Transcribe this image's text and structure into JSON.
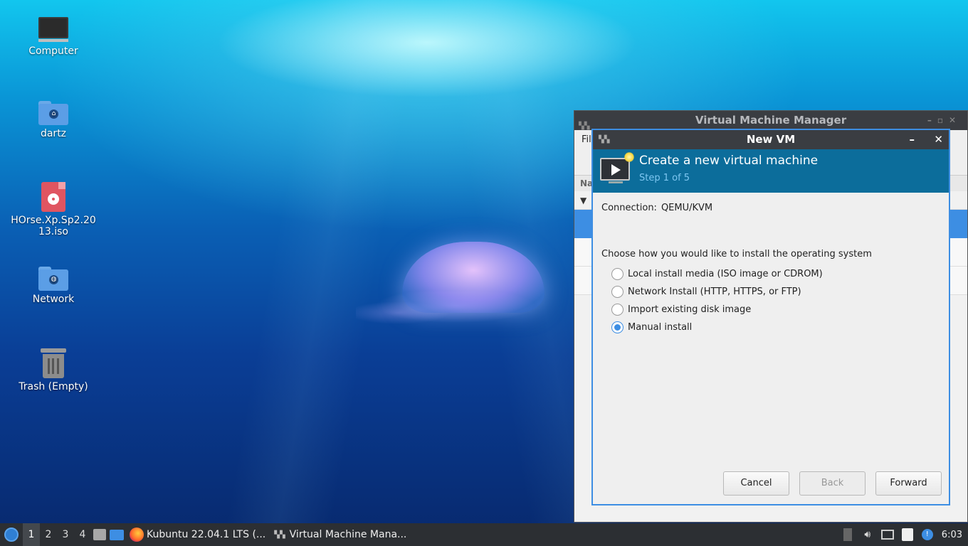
{
  "desktop": {
    "icons": [
      {
        "label": "Computer"
      },
      {
        "label": "dartz"
      },
      {
        "label": "HOrse.Xp.Sp2.2013.iso"
      },
      {
        "label": "Network"
      },
      {
        "label": "Trash (Empty)"
      }
    ]
  },
  "vmm_window": {
    "title": "Virtual Machine Manager",
    "menu_label": "Fil",
    "list_header": "Na"
  },
  "new_vm_dialog": {
    "title": "New VM",
    "heading": "Create a new virtual machine",
    "step": "Step 1 of 5",
    "connection_label": "Connection:",
    "connection_value": "QEMU/KVM",
    "prompt": "Choose how you would like to install the operating system",
    "options": [
      {
        "label": "Local install media (ISO image or CDROM)",
        "selected": false
      },
      {
        "label": "Network Install (HTTP, HTTPS, or FTP)",
        "selected": false
      },
      {
        "label": "Import existing disk image",
        "selected": false
      },
      {
        "label": "Manual install",
        "selected": true
      }
    ],
    "buttons": {
      "cancel": "Cancel",
      "back": "Back",
      "forward": "Forward"
    }
  },
  "taskbar": {
    "workspaces": [
      "1",
      "2",
      "3",
      "4"
    ],
    "active_workspace": "1",
    "tasks": [
      {
        "label": "Kubuntu 22.04.1 LTS (...",
        "icon": "firefox-icon"
      },
      {
        "label": "Virtual Machine Mana...",
        "icon": "virt-manager-icon"
      }
    ],
    "clock": "6:03"
  },
  "colors": {
    "accent": "#3d8ee3",
    "banner": "#0c6d9b",
    "titlebar": "#3a3d42"
  }
}
